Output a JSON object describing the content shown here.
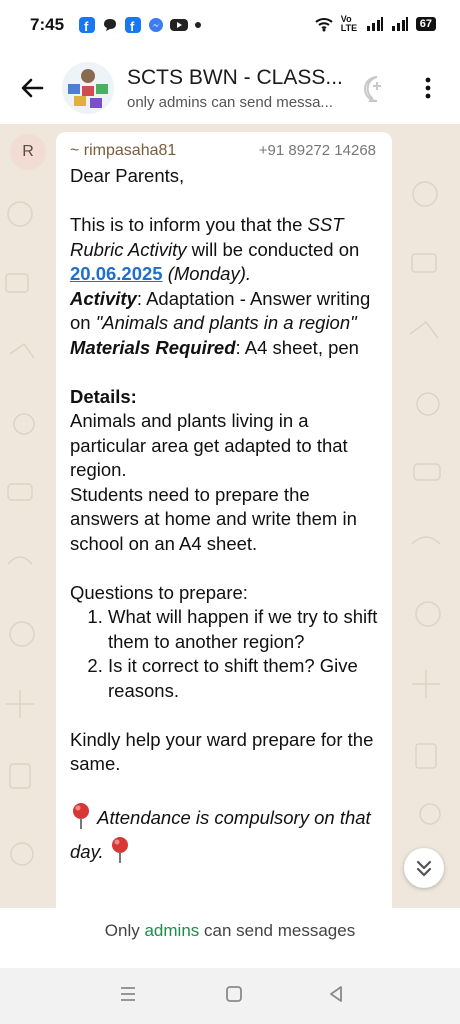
{
  "status_bar": {
    "time": "7:45",
    "volte_label": "Vo LTE",
    "battery": "67"
  },
  "header": {
    "title": "SCTS BWN - CLASS...",
    "subtitle": "only admins can send messa..."
  },
  "message": {
    "avatar_letter": "R",
    "sender_name": "~ rimpasaha81",
    "sender_phone": "+91 89272 14268",
    "greeting": "Dear Parents,",
    "intro_1": "This is to inform you that the ",
    "intro_italic": "SST Rubric Activity",
    "intro_2": " will be conducted on ",
    "date": "20.06.2025",
    "day": " (Monday).",
    "activity_label": "Activity",
    "activity_text": ": Adaptation - Answer writing on ",
    "activity_topic": "\"Animals and plants in a region\"",
    "materials_label": "Materials Required",
    "materials_text": ": A4 sheet, pen",
    "details_label": "Details:",
    "details_1": "Animals and plants living in a particular area get adapted to that region.",
    "details_2": "Students need to prepare the answers at home and write them in school on an A4 sheet.",
    "questions_label": "Questions to prepare:",
    "questions": [
      "What will happen if we try to shift them to another region?",
      "Is it correct to shift them? Give reasons."
    ],
    "closing": "Kindly help your ward prepare for the same.",
    "attendance": "Attendance is compulsory on that day."
  },
  "footer": {
    "text_before": "Only ",
    "admins_link": "admins",
    "text_after": " can send messages"
  },
  "icons": {
    "back": "arrow-left-icon",
    "call": "add-call-icon",
    "menu": "more-vertical-icon",
    "scroll": "double-chevron-down-icon",
    "pin": "round-pushpin-icon"
  },
  "colors": {
    "link": "#1f6fcd",
    "admins": "#1e8d4a",
    "sender_name": "#7a5c3f",
    "chat_background": "#efe7dc"
  }
}
